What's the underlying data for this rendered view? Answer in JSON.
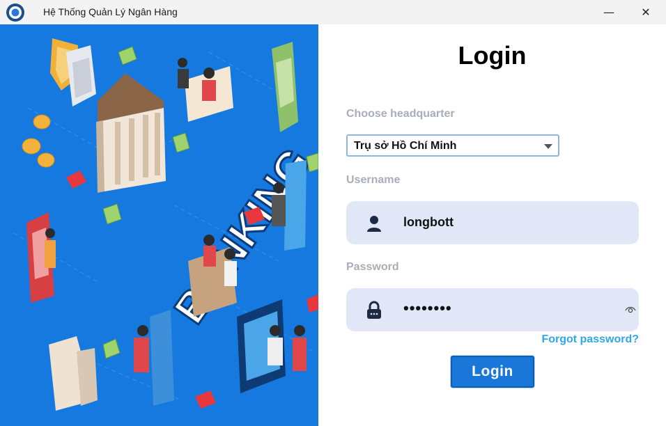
{
  "window": {
    "title": "Hệ Thống Quản Lý Ngân Hàng",
    "minimize_glyph": "—",
    "close_glyph": "✕"
  },
  "illustration": {
    "banner_text": "BANKING",
    "bg_color": "#1579e0"
  },
  "login": {
    "heading": "Login",
    "headquarter_label": "Choose headquarter",
    "headquarter_value": "Trụ sở Hồ Chí Minh",
    "username_label": "Username",
    "username_value": "longbott",
    "password_label": "Password",
    "password_masked": "••••••••",
    "forgot_label": "Forgot password?",
    "button_label": "Login"
  },
  "icons": {
    "user": "user-icon",
    "lock": "lock-icon",
    "eye": "eye-icon",
    "dropdown": "chevron-down-icon"
  },
  "colors": {
    "accent": "#1877d9",
    "field_bg": "#e1e7f7",
    "link": "#2fa7e6",
    "label": "#a8aeb8"
  }
}
